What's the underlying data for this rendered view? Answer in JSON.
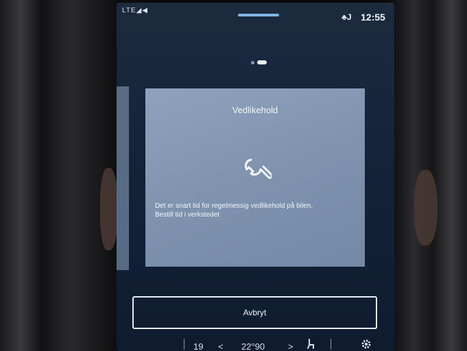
{
  "status_bar": {
    "signal": "LTE◢◀",
    "user_icon": "driver-profile-icon",
    "user": "♣J",
    "clock": "12:55"
  },
  "page_indicator": {
    "count": 2,
    "active_index": 1
  },
  "card": {
    "title": "Vedlikehold",
    "icon": "wrench-icon",
    "message_line1": "Det er snart tid for regelmessig vedlikehold på bilen.",
    "message_line2": "Bestill tid i verkstedet"
  },
  "actions": {
    "cancel_label": "Avbryt"
  },
  "bottom_bar": {
    "temp_left": "19",
    "temp_right": "22°90",
    "chevron_left": "<",
    "chevron_right": ">",
    "seat_icon": "seat-icon",
    "settings_icon": "gear-icon"
  },
  "colors": {
    "screen_bg": "#14233a",
    "card_bg": "#8196b1",
    "text": "#f4f6fa"
  }
}
